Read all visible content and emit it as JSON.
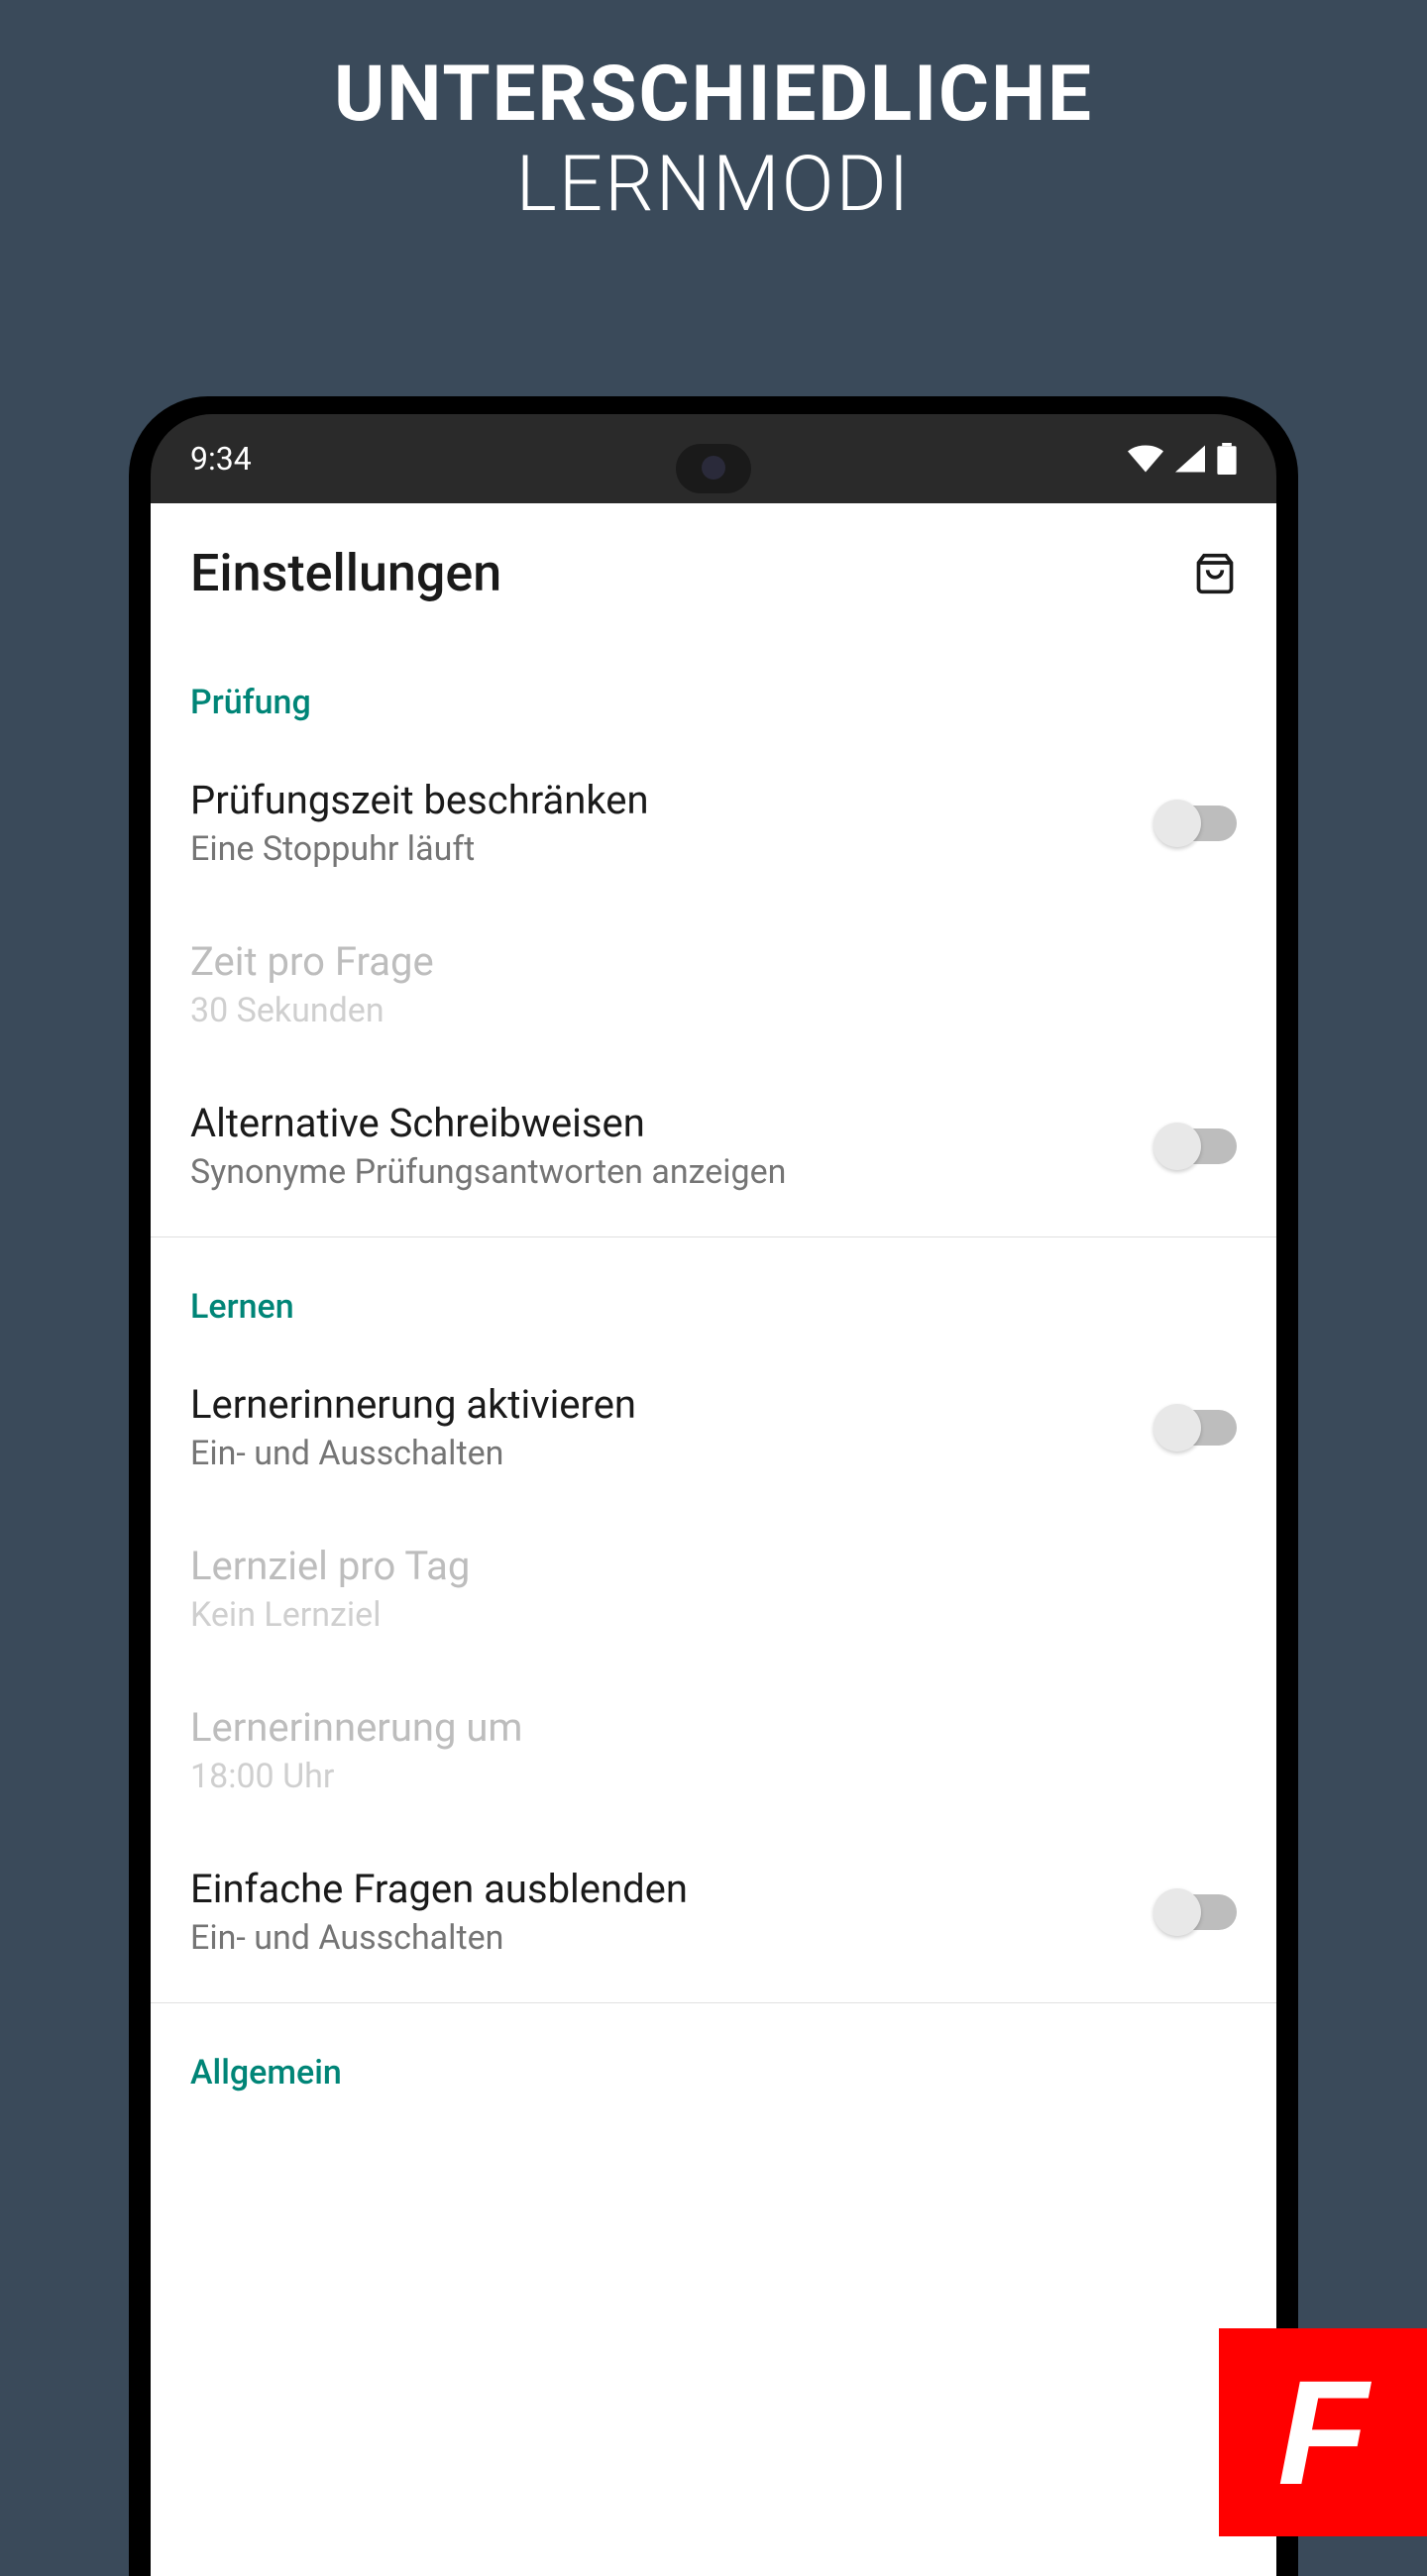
{
  "promo": {
    "line1": "UNTERSCHIEDLICHE",
    "line2": "LERNMODI"
  },
  "status_bar": {
    "time": "9:34"
  },
  "header": {
    "title": "Einstellungen"
  },
  "sections": {
    "pruefung": {
      "label": "Prüfung",
      "items": [
        {
          "title": "Prüfungszeit beschränken",
          "subtitle": "Eine Stoppuhr läuft",
          "toggle": false,
          "disabled": false
        },
        {
          "title": "Zeit pro Frage",
          "subtitle": "30 Sekunden",
          "toggle": null,
          "disabled": true
        },
        {
          "title": "Alternative Schreibweisen",
          "subtitle": "Synonyme Prüfungsantworten anzeigen",
          "toggle": false,
          "disabled": false
        }
      ]
    },
    "lernen": {
      "label": "Lernen",
      "items": [
        {
          "title": "Lernerinnerung aktivieren",
          "subtitle": "Ein- und Ausschalten",
          "toggle": false,
          "disabled": false
        },
        {
          "title": "Lernziel pro Tag",
          "subtitle": "Kein Lernziel",
          "toggle": null,
          "disabled": true
        },
        {
          "title": "Lernerinnerung um",
          "subtitle": "18:00 Uhr",
          "toggle": null,
          "disabled": true
        },
        {
          "title": "Einfache Fragen ausblenden",
          "subtitle": "Ein- und Ausschalten",
          "toggle": false,
          "disabled": false
        }
      ]
    },
    "allgemein": {
      "label": "Allgemein"
    }
  },
  "corner_badge": "F"
}
